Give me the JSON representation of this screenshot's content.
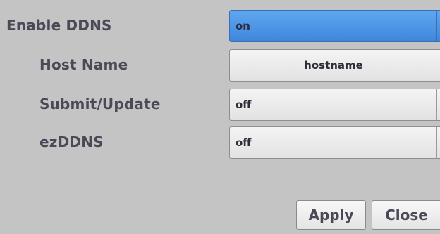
{
  "form": {
    "enable_ddns": {
      "label": "Enable DDNS",
      "value": "on"
    },
    "host_name": {
      "label": "Host Name",
      "value": "hostname"
    },
    "submit_update": {
      "label": "Submit/Update",
      "value": "off"
    },
    "ezddns": {
      "label": "ezDDNS",
      "value": "off"
    }
  },
  "buttons": {
    "apply": "Apply",
    "close": "Close"
  },
  "icons": {
    "dropdown": "chevron-down-icon"
  },
  "colors": {
    "background": "#c4c4c4",
    "active_field": "#4f97e8",
    "label_text": "#4a4a57"
  }
}
